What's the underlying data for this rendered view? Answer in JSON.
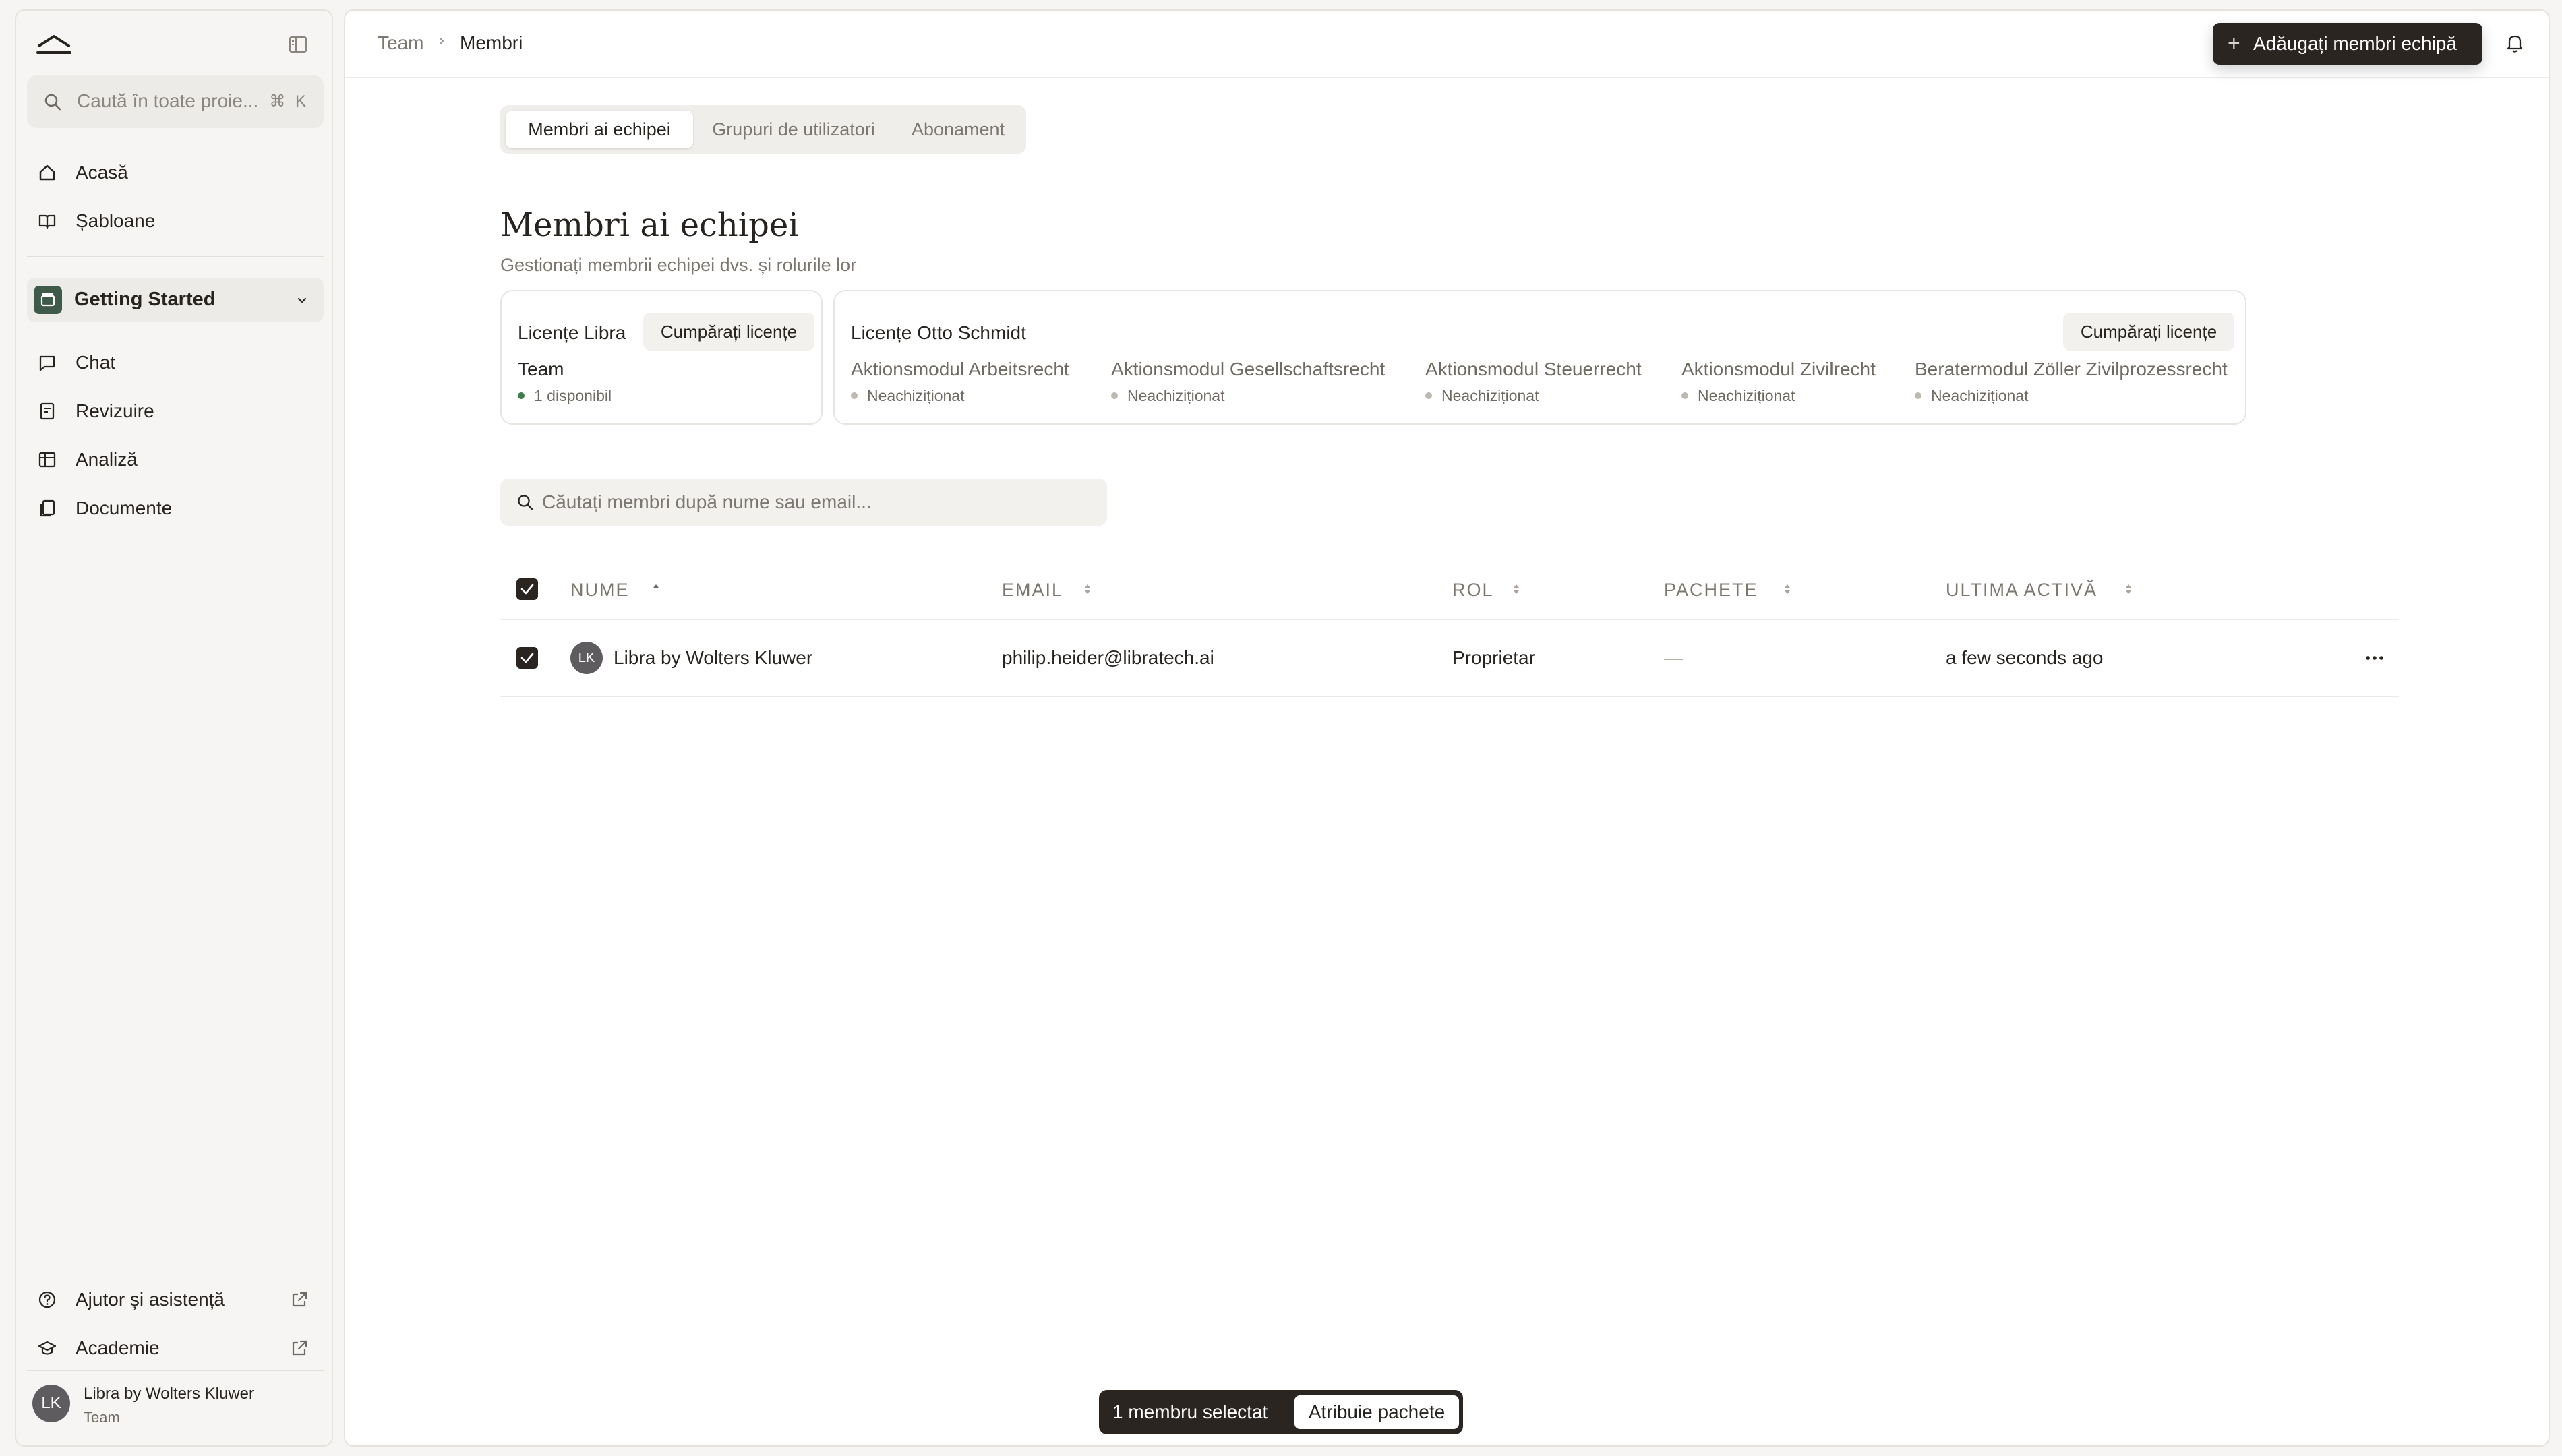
{
  "sidebar": {
    "search": {
      "placeholder": "Caută în toate proie...",
      "shortcut": "⌘ K"
    },
    "nav": [
      {
        "label": "Acasă",
        "icon": "home-icon"
      },
      {
        "label": "Șabloane",
        "icon": "book-icon"
      }
    ],
    "project": {
      "label": "Getting Started",
      "icon": "folder-icon"
    },
    "project_nav": [
      {
        "label": "Chat",
        "icon": "chat-icon"
      },
      {
        "label": "Revizuire",
        "icon": "review-icon"
      },
      {
        "label": "Analiză",
        "icon": "table-icon"
      },
      {
        "label": "Documente",
        "icon": "documents-icon"
      }
    ],
    "footer_nav": [
      {
        "label": "Ajutor și asistență",
        "icon": "help-icon"
      },
      {
        "label": "Academie",
        "icon": "graduation-cap-icon"
      }
    ],
    "user": {
      "initials": "LK",
      "name": "Libra by Wolters Kluwer",
      "team": "Team"
    }
  },
  "header": {
    "breadcrumb": [
      "Team",
      "Membri"
    ],
    "add_button": "Adăugați membri echipă"
  },
  "tabs": [
    {
      "label": "Membri ai echipei",
      "active": true
    },
    {
      "label": "Grupuri de utilizatori",
      "active": false
    },
    {
      "label": "Abonament",
      "active": false
    }
  ],
  "page": {
    "title": "Membri ai echipei",
    "subtitle": "Gestionați membrii echipei dvs. și rolurile lor"
  },
  "licenses": {
    "libra": {
      "title": "Licențe Libra",
      "buy_label": "Cumpărați licențe",
      "plan": "Team",
      "status": "1 disponibil",
      "status_color": "#3d7d4c"
    },
    "otto": {
      "title": "Licențe Otto Schmidt",
      "buy_label": "Cumpărați licențe",
      "modules": [
        {
          "name": "Aktionsmodul Arbeitsrecht",
          "status": "Neachiziționat"
        },
        {
          "name": "Aktionsmodul Gesellschaftsrecht",
          "status": "Neachiziționat"
        },
        {
          "name": "Aktionsmodul Steuerrecht",
          "status": "Neachiziționat"
        },
        {
          "name": "Aktionsmodul Zivilrecht",
          "status": "Neachiziționat"
        },
        {
          "name": "Beratermodul Zöller Zivilprozessrecht",
          "status": "Neachiziționat"
        }
      ]
    }
  },
  "member_search": {
    "placeholder": "Căutați membri după nume sau email..."
  },
  "table": {
    "columns": [
      "NUME",
      "EMAIL",
      "ROL",
      "PACHETE",
      "ULTIMA ACTIVĂ"
    ],
    "rows": [
      {
        "checked": true,
        "initials": "LK",
        "name": "Libra by Wolters Kluwer",
        "email": "philip.heider@libratech.ai",
        "role": "Proprietar",
        "packages": "—",
        "last_active": "a few seconds ago"
      }
    ]
  },
  "selection_bar": {
    "count_label": "1 membru selectat",
    "action_label": "Atribuie pachete"
  },
  "colors": {
    "accent_dark": "#2b2521",
    "project_icon": "#3f5a48",
    "available_dot": "#3d7d4c"
  }
}
